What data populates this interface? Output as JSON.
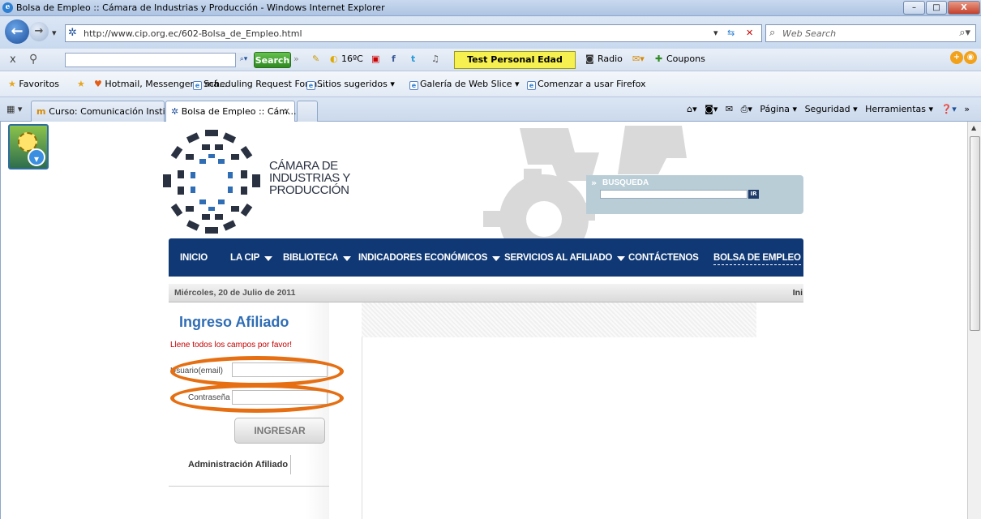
{
  "browser": {
    "window_title": "Bolsa de Empleo :: Cámara de Industrias y Producción - Windows Internet Explorer",
    "url": "http://www.cip.org.ec/602-Bolsa_de_Empleo.html",
    "search_placeholder": "Web Search",
    "toolbar": {
      "search_label": "Search",
      "weather": "16ºC",
      "test_button": "Test Personal Edad Corporal",
      "radio": "Radio",
      "coupons": "Coupons"
    },
    "favorites": {
      "label": "Favoritos",
      "items": [
        "Hotmail, Messenger y má...",
        "Scheduling Request Form ...",
        "Sitios sugeridos ▾",
        "Galería de Web Slice ▾",
        "Comenzar a usar Firefox"
      ]
    },
    "tabs": [
      {
        "label": "Curso: Comunicación Insti..."
      },
      {
        "label": "Bolsa de Empleo :: Cám..."
      }
    ],
    "commands": [
      "Página ▾",
      "Seguridad ▾",
      "Herramientas ▾"
    ]
  },
  "site": {
    "logo_lines": [
      "CÁMARA DE",
      "INDUSTRIAS Y",
      "PRODUCCIÓN"
    ],
    "search_label": "BUSQUEDA",
    "search_button": "IR",
    "nav": [
      {
        "label": "INICIO"
      },
      {
        "label": "LA CIP"
      },
      {
        "label": "BIBLIOTECA"
      },
      {
        "label": "INDICADORES ECONÓMICOS"
      },
      {
        "label": "SERVICIOS AL AFILIADO"
      },
      {
        "label": "CONTÁCTENOS"
      },
      {
        "label": "BOLSA DE EMPLEO"
      }
    ],
    "date": "Miércoles, 20 de Julio de 2011",
    "date_right": "Ini",
    "login": {
      "title": "Ingreso Afiliado",
      "message": "Llene todos los campos por favor!",
      "user_label": "Usuario(email)",
      "password_label": "Contraseña",
      "button": "INGRESAR",
      "admin_link": "Administración Afiliado"
    }
  },
  "colors": {
    "nav_bg": "#0f3875",
    "login_title": "#2f6db5",
    "annotation": "#e56f12"
  }
}
